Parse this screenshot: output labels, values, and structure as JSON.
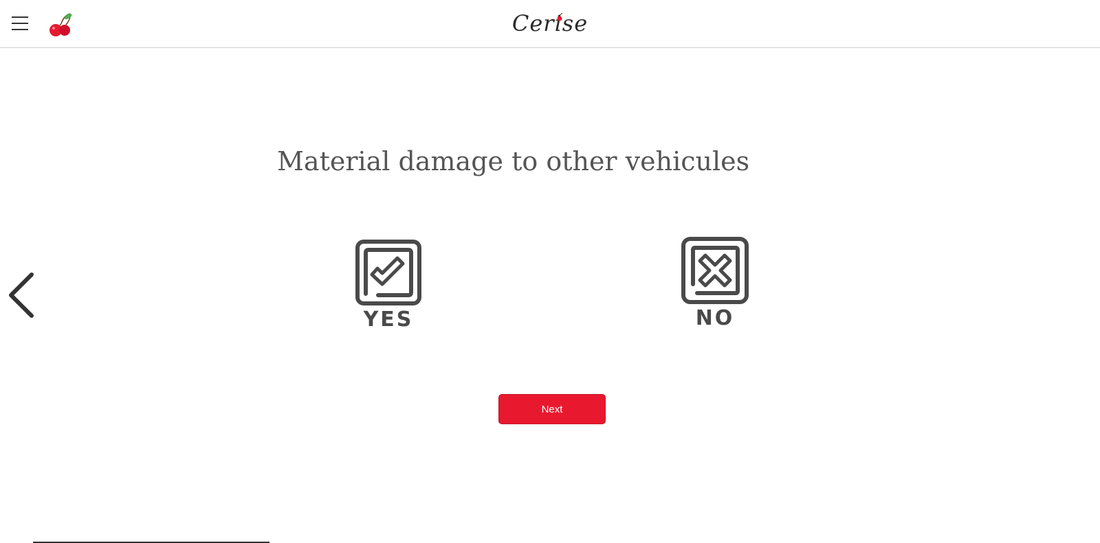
{
  "header": {
    "brand": "Cerise",
    "menu_icon": "hamburger-menu-icon",
    "logo_icon": "cherry-logo-icon"
  },
  "navigation": {
    "back_icon": "chevron-left-icon"
  },
  "question": {
    "title": "Material damage to other vehicules"
  },
  "options": [
    {
      "label": "YES",
      "icon": "checkbox-checked-icon"
    },
    {
      "label": "NO",
      "icon": "checkbox-cross-icon"
    }
  ],
  "actions": {
    "next_label": "Next"
  },
  "colors": {
    "accent": "#e8192f",
    "text": "#555555",
    "icon": "#4a4a4a"
  }
}
